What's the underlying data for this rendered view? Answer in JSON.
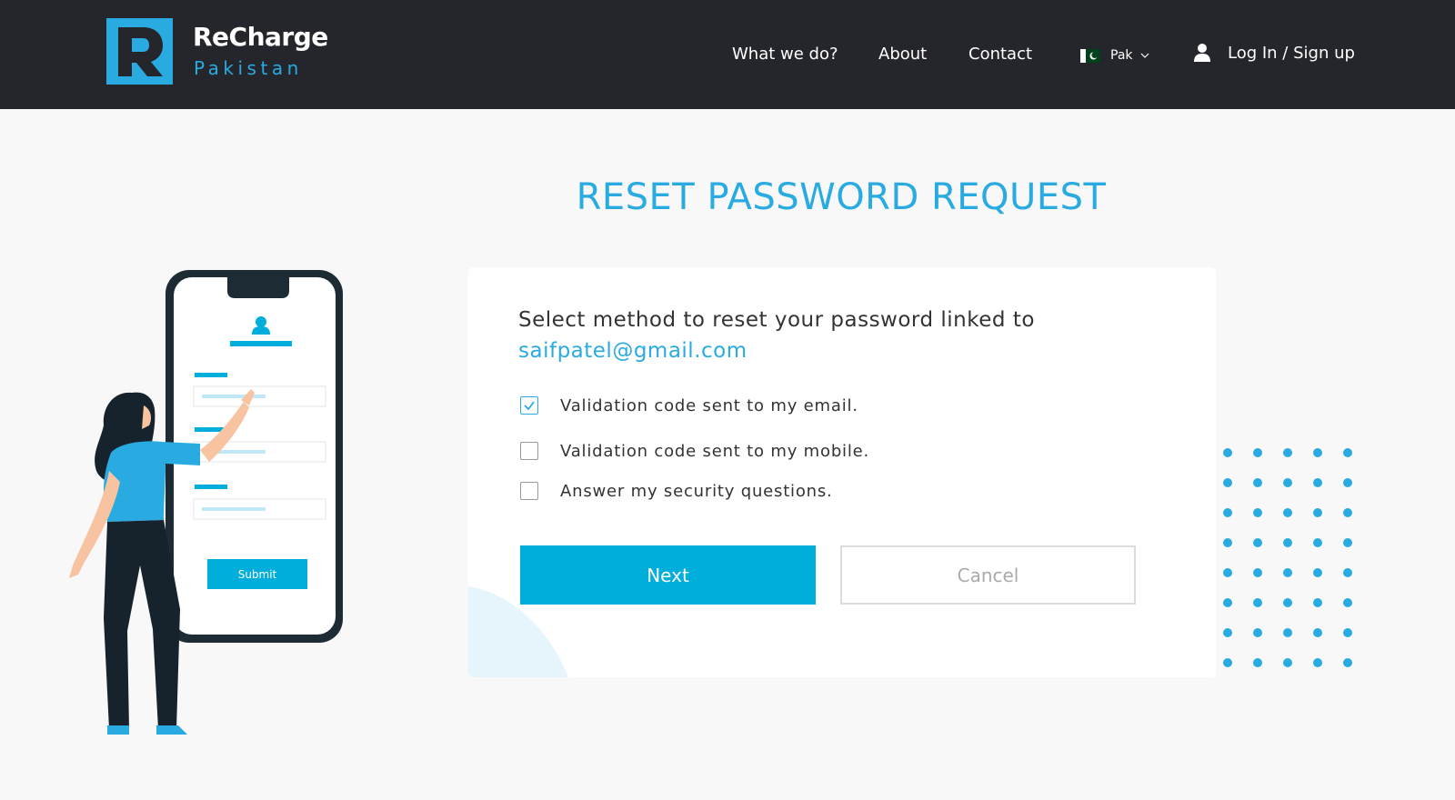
{
  "header": {
    "brand_name": "ReCharge",
    "brand_sub": "Pakistan",
    "nav": [
      "What we do?",
      "About",
      "Contact"
    ],
    "language": "Pak",
    "login_label": "Log In / Sign up",
    "icons": {
      "logo": "recharge-logo-icon",
      "flag": "pakistan-flag-icon",
      "chevron": "chevron-down-icon",
      "user": "user-icon"
    }
  },
  "page": {
    "title": "RESET PASSWORD REQUEST"
  },
  "form": {
    "prompt": "Select method to reset your password linked to",
    "email": "saifpatel@gmail.com",
    "options": [
      {
        "label": "Validation code sent to my email.",
        "checked": true
      },
      {
        "label": "Validation code sent to my mobile.",
        "checked": false
      },
      {
        "label": "Answer my security questions.",
        "checked": false
      }
    ],
    "next_label": "Next",
    "cancel_label": "Cancel"
  },
  "illustration": {
    "submit_label": "Submit"
  },
  "colors": {
    "header_bg": "#25262b",
    "accent": "#29abe2",
    "button": "#00aedb",
    "page_bg": "#f8f8f8"
  }
}
